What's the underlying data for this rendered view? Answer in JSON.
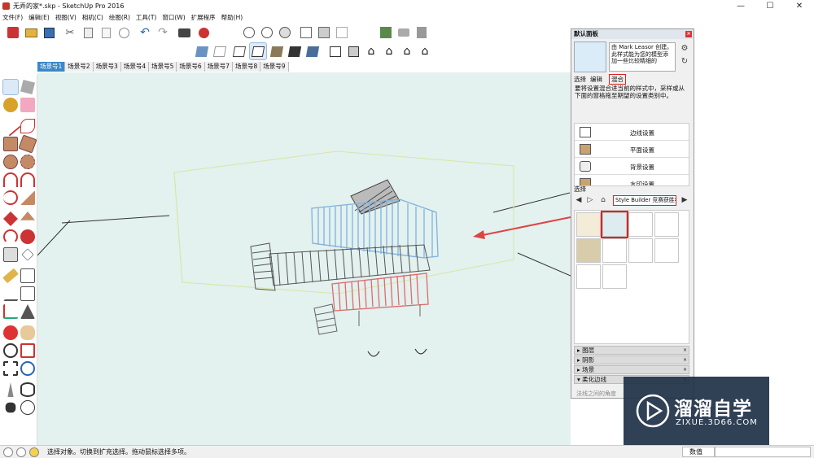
{
  "window": {
    "title": "无弄的家*.skp - SketchUp Pro 2016",
    "controls": [
      "—",
      "☐",
      "✕"
    ]
  },
  "menu": [
    "文件(F)",
    "编辑(E)",
    "视图(V)",
    "相机(C)",
    "绘图(R)",
    "工具(T)",
    "窗口(W)",
    "扩展程序",
    "帮助(H)"
  ],
  "scenes": {
    "tabs": [
      "场景号1",
      "场景号2",
      "场景号3",
      "场景号4",
      "场景号5",
      "场景号6",
      "场景号7",
      "场景号8",
      "场景号9"
    ],
    "active_index": 0
  },
  "tray": {
    "title": "默认面板",
    "close": "×",
    "style_description": "由 Mark Leasor 创建。此样式能为您的模型添加一些比较精细的",
    "tabs": {
      "select": "选择",
      "edit": "编辑",
      "mix": "混合"
    },
    "mix_description": "要将设置混合进当前的样式中，采样或从下面的窗格拖至期望的设置类别中。",
    "settings": [
      {
        "label": "边线设置",
        "icon": "edge-settings-icon"
      },
      {
        "label": "平面设置",
        "icon": "face-settings-icon"
      },
      {
        "label": "背景设置",
        "icon": "background-settings-icon"
      },
      {
        "label": "水印设置",
        "icon": "watermark-settings-icon"
      }
    ],
    "select_label": "选择",
    "library": "Style Builder 竞赛获胜者",
    "panels": [
      {
        "label": "图层",
        "state": "collapsed"
      },
      {
        "label": "阴影",
        "state": "collapsed"
      },
      {
        "label": "场景",
        "state": "collapsed"
      },
      {
        "label": "柔化边线",
        "state": "expanded"
      }
    ],
    "panel_hint": "法线之间的角度"
  },
  "watermark": {
    "title": "溜溜自学",
    "subtitle": "ZIXUE.3D66.COM"
  },
  "status": {
    "text": "选择对象。切换到扩充选择。拖动鼠标选择多项。",
    "measure_label": "数值",
    "icons": [
      "geo-location-icon",
      "credits-icon",
      "info-icon"
    ]
  },
  "colors": {
    "accent_blue": "#3b87c8",
    "highlight_red": "#dd2222",
    "viewport_bg": "#e3f1ef",
    "model_blue": "#7fb2df",
    "model_red": "#e06a6a"
  }
}
